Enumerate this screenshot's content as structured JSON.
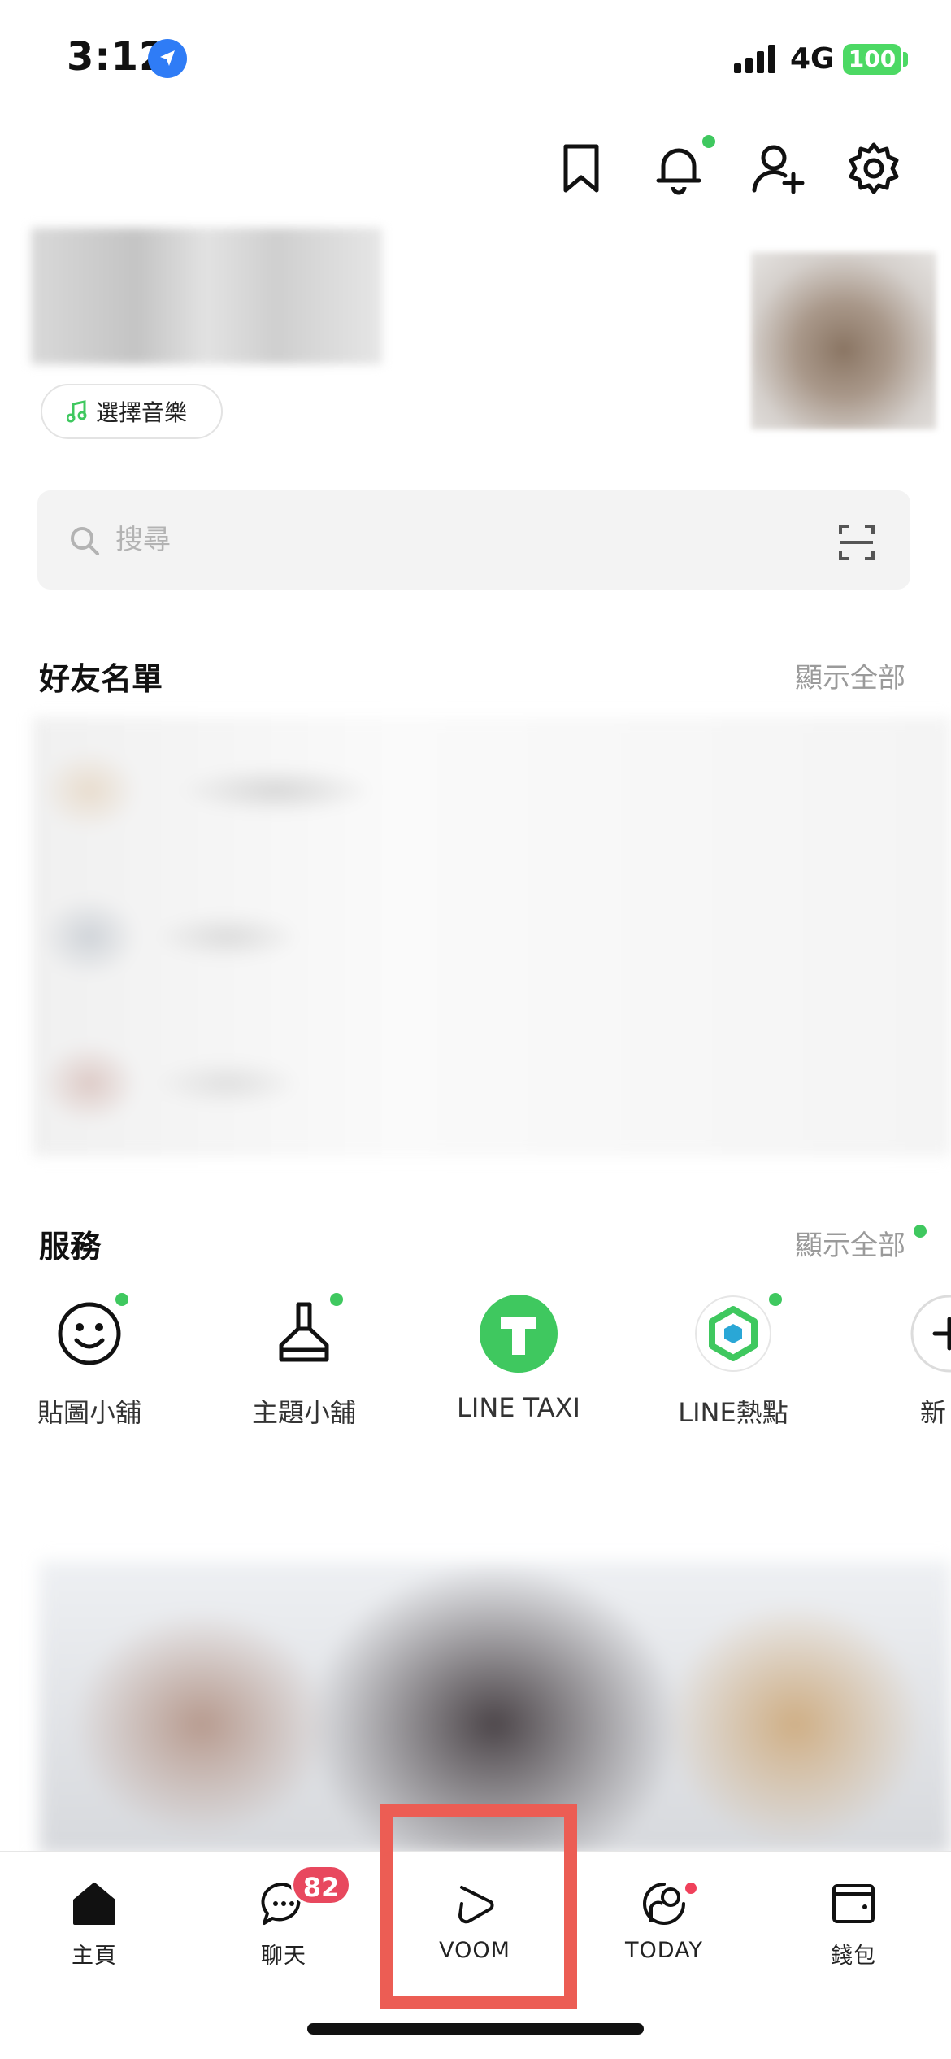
{
  "status_bar": {
    "time": "3:12",
    "network": "4G",
    "battery": "100"
  },
  "header": {
    "icons": [
      "bookmark-icon",
      "bell-icon",
      "add-friend-icon",
      "settings-icon"
    ]
  },
  "profile": {
    "music_label": "選擇音樂"
  },
  "search": {
    "placeholder": "搜尋"
  },
  "friends": {
    "title": "好友名單",
    "show_all": "顯示全部"
  },
  "services": {
    "title": "服務",
    "show_all": "顯示全部",
    "items": [
      {
        "label": "貼圖小舖",
        "icon": "smiley-icon"
      },
      {
        "label": "主題小舖",
        "icon": "brush-icon"
      },
      {
        "label": "LINE TAXI",
        "icon": "taxi-icon"
      },
      {
        "label": "LINE熱點",
        "icon": "hotspot-icon"
      },
      {
        "label": "新",
        "icon": "add-icon"
      }
    ]
  },
  "tabbar": {
    "tabs": [
      {
        "label": "主頁",
        "icon": "home-icon"
      },
      {
        "label": "聊天",
        "icon": "chat-icon"
      },
      {
        "label": "VOOM",
        "icon": "voom-icon"
      },
      {
        "label": "TODAY",
        "icon": "today-icon"
      },
      {
        "label": "錢包",
        "icon": "wallet-icon"
      }
    ],
    "chat_badge": "82"
  },
  "colors": {
    "accent_green": "#3fc85f",
    "badge_red": "#e8485e",
    "highlight": "#ec5d54"
  }
}
